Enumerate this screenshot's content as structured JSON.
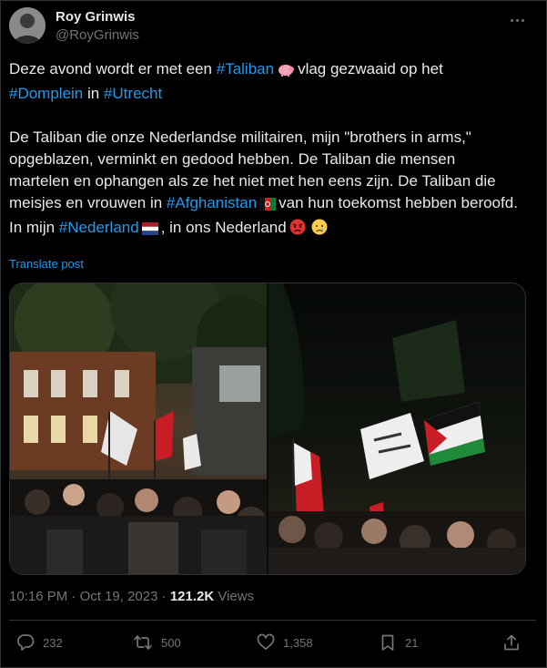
{
  "author": {
    "name": "Roy Grinwis",
    "handle": "@RoyGrinwis"
  },
  "tweet": {
    "line1_before": "Deze avond  wordt er met een ",
    "hashtag_taliban": "#Taliban",
    "line1_after": "vlag gezwaaid op het",
    "hashtag_domplein": "#Domplein",
    "word_in": " in ",
    "hashtag_utrecht": "#Utrecht",
    "para2_before": "De Taliban die onze Nederlandse militairen, mijn \"brothers in arms,\" opgeblazen, verminkt en gedood hebben. De Taliban die mensen martelen en ophangen als ze het niet met hen eens zijn. De Taliban die meisjes en vrouwen in ",
    "hashtag_afghanistan": "#Afghanistan",
    "para2_after": "van hun toekomst hebben beroofd.",
    "line_last_before": "In mijn ",
    "hashtag_nederland": "#Nederland",
    "line_last_after": ", in ons Nederland",
    "emoji_pig": "pig-emoji",
    "emoji_afghan_flag": "afghanistan-flag-emoji",
    "emoji_nl_flag": "netherlands-flag-emoji",
    "emoji_angry": "angry-face-emoji",
    "emoji_crying": "crying-face-emoji"
  },
  "translate_label": "Translate post",
  "meta": {
    "time": "10:16 PM",
    "separator": " · ",
    "date": "Oct 19, 2023",
    "views_count": "121.2K",
    "views_label": " Views"
  },
  "actions": {
    "replies": "232",
    "reposts": "500",
    "likes": "1,358",
    "bookmarks": "21"
  },
  "icons": {
    "more": "more-icon",
    "reply": "reply-icon",
    "repost": "repost-icon",
    "like": "heart-icon",
    "bookmark": "bookmark-icon",
    "share": "share-icon"
  },
  "colors": {
    "background": "#000000",
    "text": "#e7e9ea",
    "muted": "#71767b",
    "link": "#1d9bf0",
    "border": "#2f3336"
  }
}
